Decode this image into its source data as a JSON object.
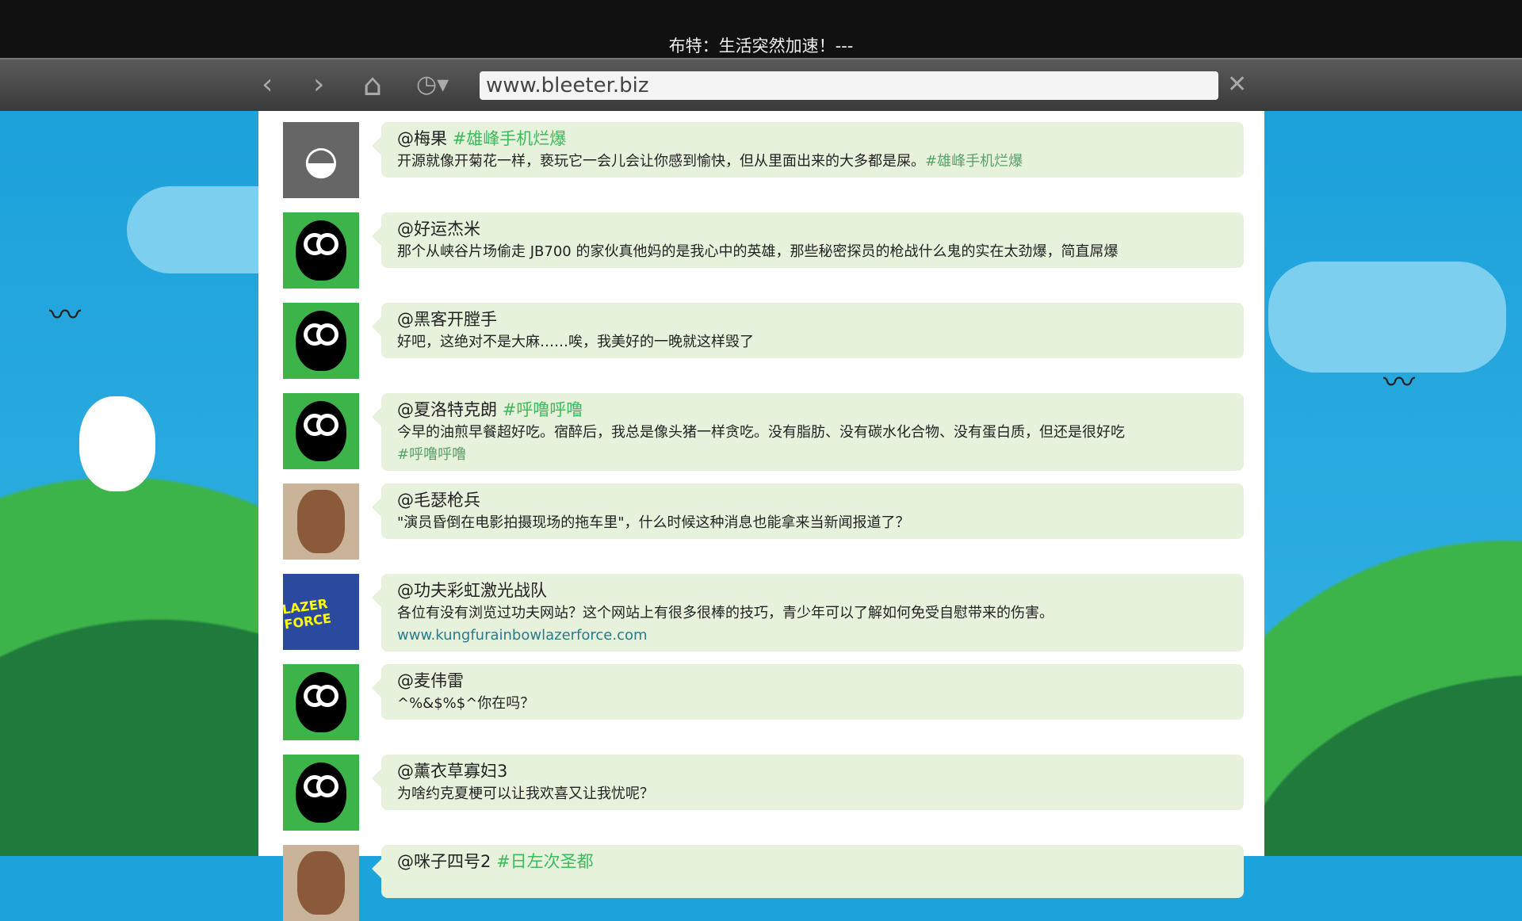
{
  "window": {
    "title": "布特：生活突然加速！---"
  },
  "toolbar": {
    "url": "www.bleeter.biz",
    "back": "‹",
    "forward": "›",
    "home": "⌂",
    "history": "◷▾",
    "close": "✕"
  },
  "colors": {
    "sky": "#1ea4dc",
    "hashtag": "#3dba5a",
    "bubble": "#e6f2dc",
    "avatar_green": "#3cb44a"
  },
  "posts": [
    {
      "user": "@梅果",
      "tag": "#雄峰手机烂爆",
      "text": "开源就像开菊花一样，亵玩它一会儿会让你感到愉快，但从里面出来的大多都是屎。",
      "text_tag": "#雄峰手机烂爆",
      "avatar": "apple-logo"
    },
    {
      "user": "@好运杰米",
      "tag": "",
      "text": "那个从峡谷片场偷走 JB700 的家伙真他妈的是我心中的英雄，那些秘密探员的枪战什么鬼的实在太劲爆，简直屌爆",
      "avatar": "sheep"
    },
    {
      "user": "@黑客开膛手",
      "tag": "",
      "text": "好吧，这绝对不是大麻……唉，我美好的一晚就这样毁了",
      "avatar": "sheep"
    },
    {
      "user": "@夏洛特克朗",
      "tag": "#呼噜呼噜",
      "text": "今早的油煎早餐超好吃。宿醉后，我总是像头猪一样贪吃。没有脂肪、没有碳水化合物、没有蛋白质，但还是很好吃",
      "text_tag": "#呼噜呼噜",
      "avatar": "sheep"
    },
    {
      "user": "@毛瑟枪兵",
      "tag": "",
      "text": "\"演员昏倒在电影拍摄现场的拖车里\"，什么时候这种消息也能拿来当新闻报道了？",
      "avatar": "photo-woman"
    },
    {
      "user": "@功夫彩虹激光战队",
      "tag": "",
      "text": "各位有没有浏览过功夫网站？这个网站上有很多很棒的技巧，青少年可以了解如何免受自慰带来的伤害。",
      "link": "www.kungfurainbowlazerforce.com",
      "avatar": "lazer-force-logo"
    },
    {
      "user": "@麦伟雷",
      "tag": "",
      "text": "^%&$%$^你在吗？",
      "avatar": "sheep"
    },
    {
      "user": "@薰衣草寡妇3",
      "tag": "",
      "text": "为啥约克夏梗可以让我欢喜又让我忧呢？",
      "avatar": "sheep"
    },
    {
      "user": "@咪子四号2",
      "tag": "#日左次圣都",
      "text": "",
      "avatar": "photo-man"
    }
  ]
}
